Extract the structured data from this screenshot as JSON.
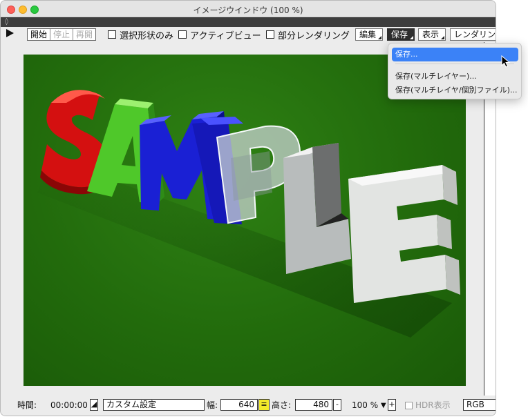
{
  "window": {
    "title": "イメージウインドウ (100 %)"
  },
  "toolbar": {
    "start_label": "開始",
    "stop_label": "停止",
    "resume_label": "再開",
    "check_selection_only": "選択形状のみ",
    "check_active_view": "アクティブビュー",
    "check_partial_render": "部分レンダリング",
    "menu_edit": "編集",
    "menu_save": "保存",
    "menu_view": "表示",
    "menu_render": "レンダリン"
  },
  "save_menu": {
    "items": [
      "保存...",
      "保存(マルチレイヤー)...",
      "保存(マルチレイヤ/個別ファイル)..."
    ]
  },
  "image": {
    "content": "3D SAMPLE text render",
    "letters": [
      "S",
      "A",
      "M",
      "P",
      "L",
      "E"
    ],
    "colors": [
      "#e01010",
      "#52d024",
      "#1d22e0",
      "#c8d2d2",
      "#c8c8c8",
      "#ececec"
    ]
  },
  "status": {
    "time_label": "時間:",
    "time_value": "00:00:00",
    "preset": "カスタム設定",
    "width_label": "幅:",
    "width_value": "640",
    "height_label": "高さ:",
    "height_value": "480",
    "minus": "-",
    "zoom": "100 %",
    "plus": "+",
    "hdr_label": "HDR表示",
    "color_mode": "RGB"
  }
}
